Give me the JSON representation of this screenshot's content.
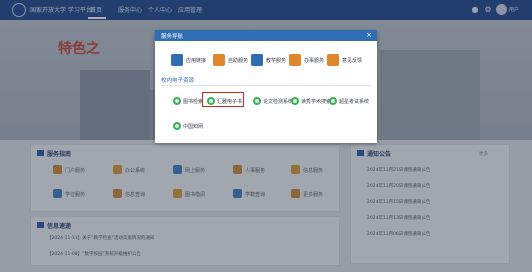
{
  "header": {
    "logo_text": "国家开放大学 学习平台",
    "nav": [
      "首页",
      "服务中心",
      "个人中心",
      "应用管理"
    ],
    "user_name": "用户"
  },
  "banner": {
    "text": "特色之"
  },
  "services_panel": {
    "title": "服务指南",
    "items": [
      "门户服务",
      "办公系统",
      "网上服务",
      "人事服务",
      "信息服务",
      "学位服务",
      "信息查询",
      "图书借阅",
      "学籍查询",
      "更多服务"
    ]
  },
  "notice_panel": {
    "title": "通知公告",
    "rows": [
      "2024年11月21日课程通知公告",
      "2024年11月20日课程通知公告",
      "2024年11月15日课程通知公告",
      "2024年11月13日课程通知公告",
      "2024年11月06日课程通知公告"
    ],
    "more": "更多"
  },
  "news_panel": {
    "title": "信息速递",
    "rows": [
      "【2024-11-11】关于“教学检查”活动实施情况的通知",
      "【2024-11-08】“数字校园”系统升级维护公告"
    ]
  },
  "modal": {
    "title": "服务导航",
    "close": "×",
    "apps": [
      {
        "label": "应用链接",
        "color": "#2f6db5"
      },
      {
        "label": "自助服务",
        "color": "#e0862d"
      },
      {
        "label": "教学服务",
        "color": "#2f6db5"
      },
      {
        "label": "办事服务",
        "color": "#e0862d"
      },
      {
        "label": "意见反馈",
        "color": "#e0862d"
      }
    ],
    "section_label": "校内电子资源",
    "resources": [
      "图书检索",
      "汇雅电子书",
      "论文检测系统",
      "读秀学术搜索",
      "超星考试系统",
      "中国知网"
    ]
  },
  "colors": {
    "header_bg": "#1e4a8f",
    "modal_header": "#2f6db5",
    "highlight": "#d8241f",
    "resource_icon": "#3fae5a"
  }
}
